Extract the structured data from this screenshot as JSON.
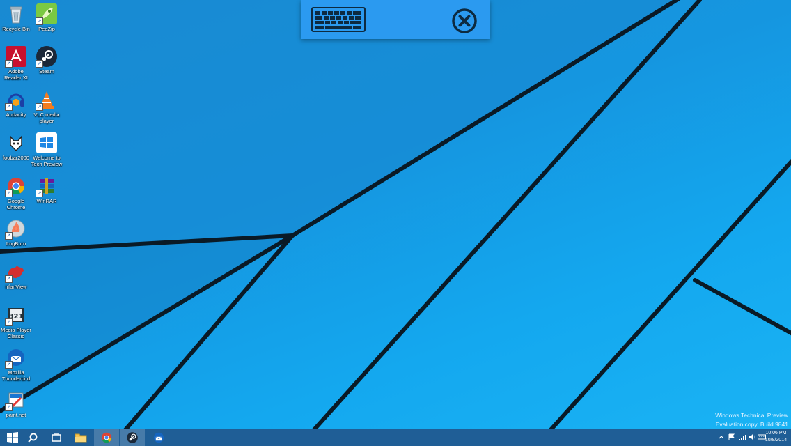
{
  "desktop": {
    "icons": [
      {
        "label": "Recycle Bin",
        "icon": "recycle-bin-icon"
      },
      {
        "label": "PeaZip",
        "icon": "peazip-icon"
      },
      {
        "label": "Adobe Reader XI",
        "icon": "adobe-reader-icon"
      },
      {
        "label": "Steam",
        "icon": "steam-icon"
      },
      {
        "label": "Audacity",
        "icon": "audacity-icon"
      },
      {
        "label": "VLC media player",
        "icon": "vlc-icon"
      },
      {
        "label": "foobar2000",
        "icon": "foobar2000-icon"
      },
      {
        "label": "Welcome to Tech Preview",
        "icon": "windows-welcome-icon"
      },
      {
        "label": "Google Chrome",
        "icon": "chrome-icon"
      },
      {
        "label": "WinRAR",
        "icon": "winrar-icon"
      },
      {
        "label": "ImgBurn",
        "icon": "imgburn-icon"
      },
      {
        "label": "IrfanView",
        "icon": "irfanview-icon"
      },
      {
        "label": "Media Player Classic",
        "icon": "media-player-classic-icon"
      },
      {
        "label": "Mozilla Thunderbird",
        "icon": "thunderbird-icon"
      },
      {
        "label": "paint.net",
        "icon": "paintnet-icon"
      }
    ]
  },
  "keyboard_bar": {
    "keyboard_icon": "keyboard-icon",
    "close_icon": "close-circle-icon"
  },
  "watermark": {
    "line1": "Windows Technical Preview",
    "line2": "Evaluation copy. Build 9841"
  },
  "taskbar": {
    "buttons": [
      "start-icon",
      "search-icon",
      "task-view-icon",
      "file-explorer-icon",
      "chrome-icon",
      "steam-icon",
      "thunderbird-icon"
    ],
    "tray": [
      "chevron-up-icon",
      "flag-icon",
      "network-icon",
      "volume-icon",
      "keyboard-icon"
    ],
    "time": "10:06 PM",
    "date": "10/8/2014"
  },
  "colors": {
    "taskbar": "#1f5e96",
    "keyboard_bar": "#2b9af0",
    "wallpaper": "#1596e0"
  }
}
